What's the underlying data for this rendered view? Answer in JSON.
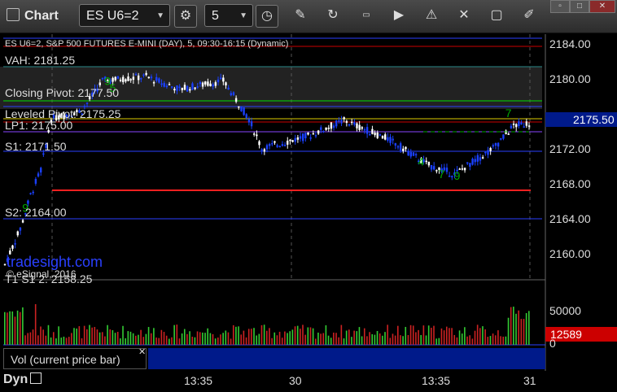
{
  "toolbar": {
    "window_title": "Chart",
    "symbol_value": "ES U6=2",
    "interval_value": "5",
    "icons": [
      "settings-icon",
      "clock-icon",
      "pencil-icon",
      "refresh-icon",
      "news-icon",
      "play-icon",
      "alert-icon",
      "tools-icon",
      "chat-icon",
      "edit-icon"
    ]
  },
  "window_controls": [
    "restore",
    "maximize",
    "close"
  ],
  "chart": {
    "title": "ES U6=2, S&P 500 FUTURES E-MINI (DAY), 5, 09:30-16:15 (Dynamic)",
    "current_price_label": "2175.50",
    "volume_label": "12589",
    "watermark": "tradesight.com",
    "copyright": "© eSignal, 2016",
    "bottom_left": "Dyn",
    "vol_panel_label": "Vol (current price bar)"
  },
  "levels": {
    "vah": "VAH: 2181.25",
    "closing_pivot": "Closing Pivot: 2177.50",
    "leveled_pivot": "Leveled Pivot: 2175.25",
    "lp1": "LP1: 2175.00",
    "s1": "S1: 2171.50",
    "s2": "S2: 2164.00",
    "t1_s1": "T1 S1 2: 2158.25"
  },
  "chart_data": {
    "type": "candlestick",
    "y_ticks": [
      "2184.00",
      "2180.00",
      "2176.00",
      "2172.00",
      "2168.00",
      "2164.00",
      "2160.00"
    ],
    "ylim": [
      2157,
      2186
    ],
    "x_ticks": [
      "13:35",
      "30",
      "13:35",
      "31"
    ],
    "volume_ticks": [
      "50000",
      "0"
    ],
    "marker_labels": [
      "9",
      "9",
      "5",
      "4",
      "7",
      "9",
      "7"
    ],
    "colors": {
      "price_box": "#001a8a",
      "volume_box": "#cc0000",
      "up_candle": "#ffffff",
      "down_candle": "#1a40ff",
      "marker": "#00aa00"
    }
  }
}
